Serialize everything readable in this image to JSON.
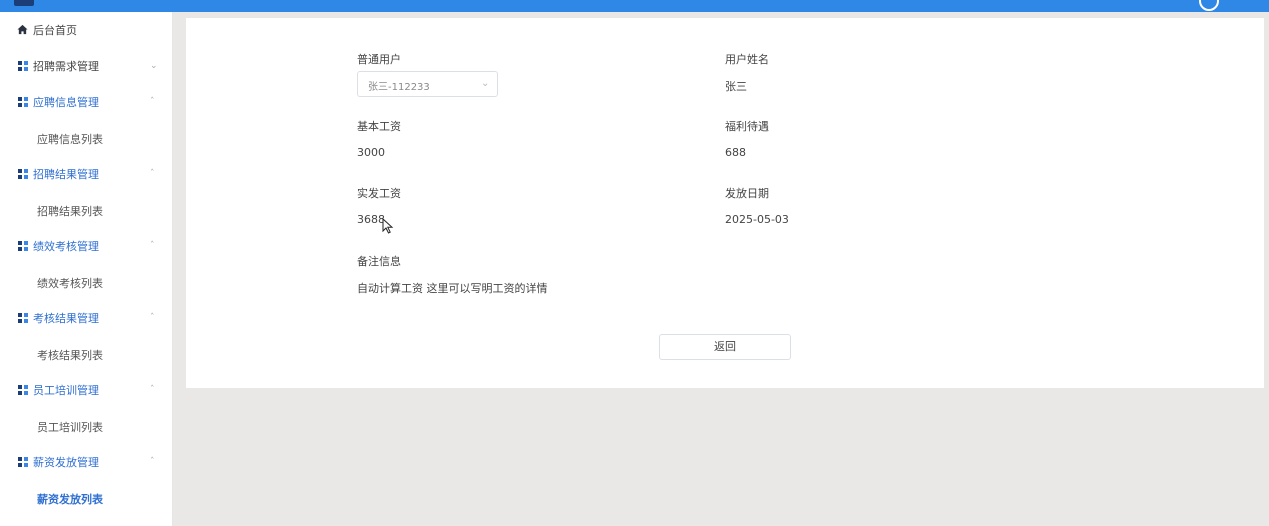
{
  "sidebar": {
    "home": "后台首页",
    "groups": [
      {
        "label": "招聘需求管理",
        "expanded": false
      },
      {
        "label": "应聘信息管理",
        "expanded": true,
        "child": "应聘信息列表"
      },
      {
        "label": "招聘结果管理",
        "expanded": true,
        "child": "招聘结果列表"
      },
      {
        "label": "绩效考核管理",
        "expanded": true,
        "child": "绩效考核列表"
      },
      {
        "label": "考核结果管理",
        "expanded": true,
        "child": "考核结果列表"
      },
      {
        "label": "员工培训管理",
        "expanded": true,
        "child": "员工培训列表"
      },
      {
        "label": "薪资发放管理",
        "expanded": true,
        "child": "薪资发放列表",
        "active": true
      }
    ]
  },
  "form": {
    "user_label": "普通用户",
    "user_select_value": "张三-112233",
    "name_label": "用户姓名",
    "name_value": "张三",
    "base_salary_label": "基本工资",
    "base_salary_value": "3000",
    "benefits_label": "福利待遇",
    "benefits_value": "688",
    "actual_salary_label": "实发工资",
    "actual_salary_value": "3688",
    "pay_date_label": "发放日期",
    "pay_date_value": "2025-05-03",
    "remark_label": "备注信息",
    "remark_value": "自动计算工资 这里可以写明工资的详情",
    "back_button": "返回"
  },
  "colors": {
    "topbar": "#2f88e6",
    "accent": "#2f6fd1",
    "page_bg": "#e9e8e6"
  }
}
